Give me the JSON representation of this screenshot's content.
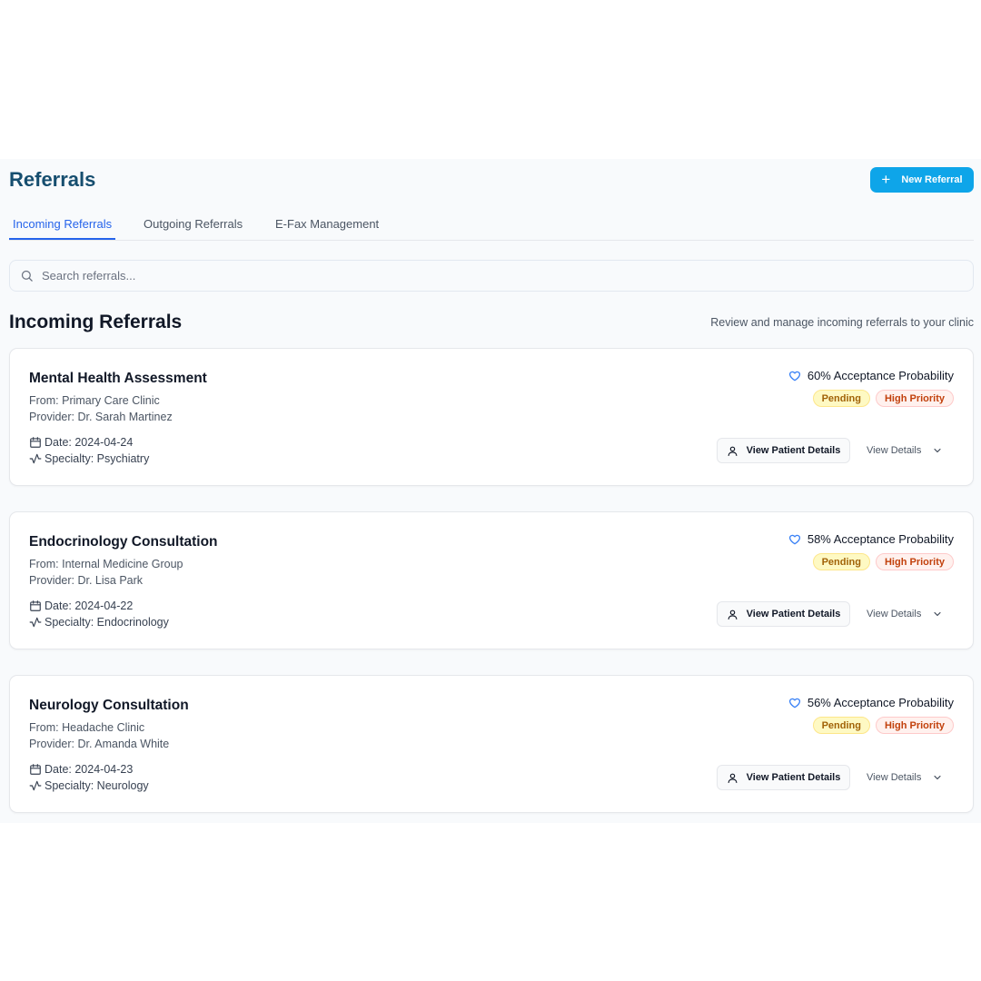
{
  "header": {
    "title": "Referrals",
    "new_button_label": "New Referral"
  },
  "tabs": [
    {
      "label": "Incoming Referrals",
      "active": true
    },
    {
      "label": "Outgoing Referrals",
      "active": false
    },
    {
      "label": "E-Fax Management",
      "active": false
    }
  ],
  "search": {
    "placeholder": "Search referrals...",
    "value": ""
  },
  "section": {
    "title": "Incoming Referrals",
    "subtitle": "Review and manage incoming referrals to your clinic"
  },
  "referrals": [
    {
      "title": "Mental Health Assessment",
      "from": "From: Primary Care Clinic",
      "provider": "Provider: Dr. Sarah Martinez",
      "date": "Date: 2024-04-24",
      "specialty": "Specialty: Psychiatry",
      "probability": "60% Acceptance Probability",
      "status": "Pending",
      "priority": "High Priority",
      "view_patient_label": "View Patient Details",
      "view_details_label": "View Details"
    },
    {
      "title": "Endocrinology Consultation",
      "from": "From: Internal Medicine Group",
      "provider": "Provider: Dr. Lisa Park",
      "date": "Date: 2024-04-22",
      "specialty": "Specialty: Endocrinology",
      "probability": "58% Acceptance Probability",
      "status": "Pending",
      "priority": "High Priority",
      "view_patient_label": "View Patient Details",
      "view_details_label": "View Details"
    },
    {
      "title": "Neurology Consultation",
      "from": "From: Headache Clinic",
      "provider": "Provider: Dr. Amanda White",
      "date": "Date: 2024-04-23",
      "specialty": "Specialty: Neurology",
      "probability": "56% Acceptance Probability",
      "status": "Pending",
      "priority": "High Priority",
      "view_patient_label": "View Patient Details",
      "view_details_label": "View Details"
    }
  ],
  "icons": {
    "plus": "plus-icon",
    "search": "search-icon",
    "heart": "heart-icon",
    "calendar": "calendar-icon",
    "activity": "activity-icon",
    "user": "user-icon",
    "chevron": "chevron-down-icon"
  },
  "colors": {
    "primary_button": "#0ea5e9",
    "title": "#164e6f",
    "active_tab": "#2563eb",
    "pending_bg": "#fef9c3",
    "priority_bg": "#fff1ee",
    "heart": "#3b82f6"
  }
}
